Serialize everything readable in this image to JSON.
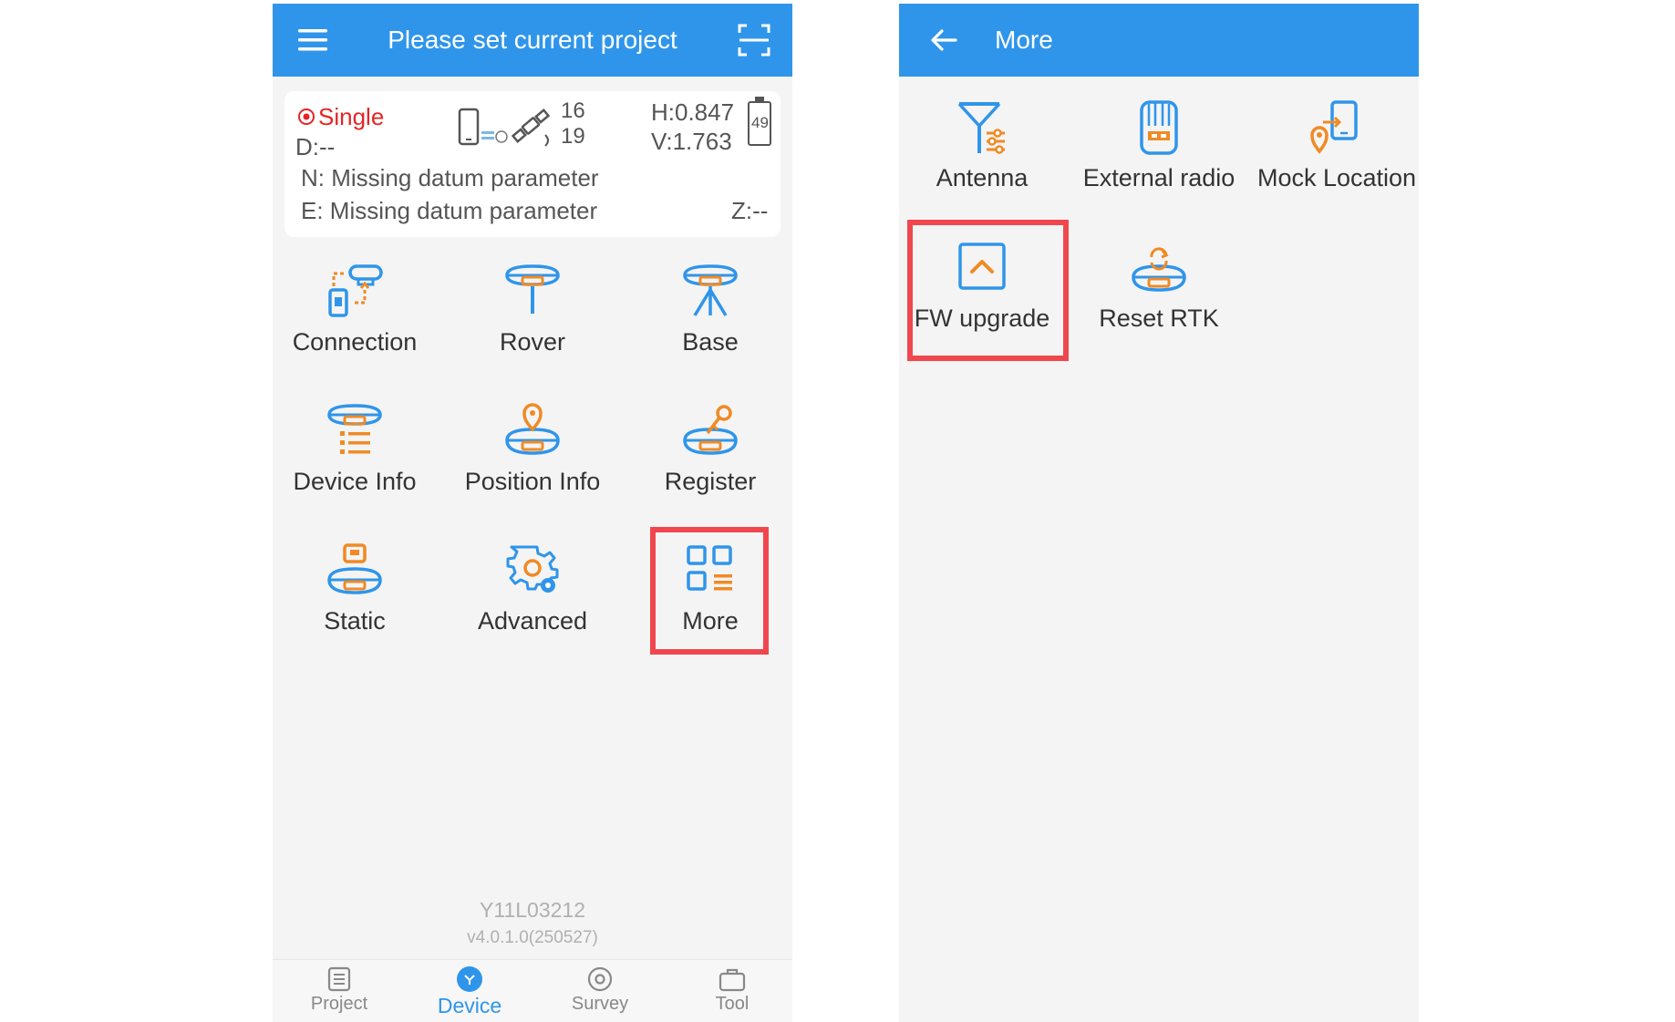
{
  "left": {
    "header": {
      "title": "Please set current project",
      "menu_icon": "hamburger-menu-icon",
      "scan_icon": "scan-icon"
    },
    "status": {
      "mode": "Single",
      "d": "D:--",
      "sat_top": "16",
      "sat_bottom": "19",
      "h": "H:0.847",
      "v": "V:1.763",
      "battery": "49",
      "n": "N: Missing datum parameter",
      "e": "E: Missing datum parameter",
      "z": "Z:--"
    },
    "tiles": [
      {
        "label": "Connection"
      },
      {
        "label": "Rover"
      },
      {
        "label": "Base"
      },
      {
        "label": "Device Info"
      },
      {
        "label": "Position Info"
      },
      {
        "label": "Register"
      },
      {
        "label": "Static"
      },
      {
        "label": "Advanced"
      },
      {
        "label": "More"
      }
    ],
    "serial": "Y11L03212",
    "version": "v4.0.1.0(250527)",
    "nav": [
      {
        "label": "Project",
        "active": false
      },
      {
        "label": "Device",
        "active": true
      },
      {
        "label": "Survey",
        "active": false
      },
      {
        "label": "Tool",
        "active": false
      }
    ]
  },
  "right": {
    "header": {
      "title": "More",
      "back_icon": "back-arrow-icon"
    },
    "tiles": [
      {
        "label": "Antenna"
      },
      {
        "label": "External radio"
      },
      {
        "label": "Mock Location"
      },
      {
        "label": "FW upgrade"
      },
      {
        "label": "Reset RTK"
      }
    ]
  },
  "colors": {
    "primary": "#2f95ea",
    "accent": "#f08a24",
    "highlight": "#f0474f",
    "status_red": "#e62424"
  }
}
